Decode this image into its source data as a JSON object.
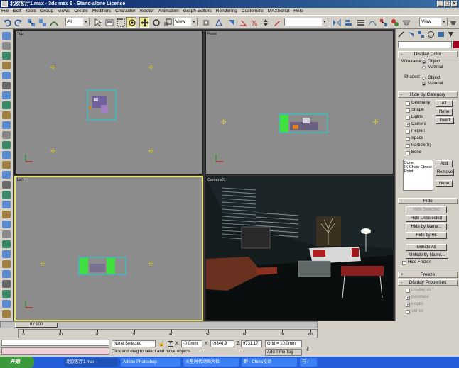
{
  "window": {
    "title": "北欧客厅1.max - 3ds max 6 - Stand-alone License"
  },
  "menu": [
    "File",
    "Edit",
    "Tools",
    "Group",
    "Views",
    "Create",
    "Modifiers",
    "Character",
    "reactor",
    "Animation",
    "Graph Editors",
    "Rendering",
    "Customize",
    "MAXScript",
    "Help"
  ],
  "toolbar": {
    "selection_filter": "All",
    "ref_coord": "View",
    "named_selection": "",
    "view_right": "View"
  },
  "viewports": [
    {
      "label": "Top"
    },
    {
      "label": "Front"
    },
    {
      "label": "Left"
    },
    {
      "label": "Camera01"
    }
  ],
  "command_panel": {
    "display_color": {
      "title": "Display Color",
      "wireframe_label": "Wireframe:",
      "shaded_label": "Shaded:",
      "object": "Object",
      "material": "Material"
    },
    "hide_by_category": {
      "title": "Hide by Category",
      "items": [
        {
          "label": "Geometry",
          "checked": false
        },
        {
          "label": "Shapes",
          "checked": false
        },
        {
          "label": "Lights",
          "checked": false
        },
        {
          "label": "Cameras",
          "checked": true
        },
        {
          "label": "Helpers",
          "checked": false
        },
        {
          "label": "Space Warps",
          "checked": false
        },
        {
          "label": "Particle Systems",
          "checked": false
        },
        {
          "label": "Bone Objects",
          "checked": false
        }
      ],
      "all_label": "All",
      "none_label": "None",
      "invert_label": "Invert",
      "list": [
        "Bone",
        "IK Chain Object",
        "Point"
      ],
      "add_label": "Add",
      "remove_label": "Remove",
      "none2_label": "None"
    },
    "hide": {
      "title": "Hide",
      "hide_selected": "Hide Selected",
      "hide_unselected": "Hide Unselected",
      "hide_by_name": "Hide by Name...",
      "hide_by_hit": "Hide by Hit",
      "unhide_all": "Unhide All",
      "unhide_by_name": "Unhide by Name...",
      "hide_frozen": "Hide Frozen"
    },
    "freeze": {
      "title": "Freeze"
    },
    "display_properties": {
      "title": "Display Properties",
      "items": [
        "Display as Box",
        "Backface Cull",
        "Edges Only",
        "Vertex Ticks"
      ]
    }
  },
  "timeline": {
    "frame_readout": "0 / 100",
    "ticks": [
      "0",
      "10",
      "20",
      "30",
      "40",
      "50",
      "60",
      "70",
      "80"
    ]
  },
  "status": {
    "selection": "None Selected",
    "prompt": "Click and drag to select and move objects",
    "x_label": "X:",
    "x_value": "-0.0mm",
    "y_label": "Y:",
    "y_value": "-9346.9",
    "z_label": "Z:",
    "z_value": "9731.17",
    "grid": "Grid = 10.0mm",
    "add_time_tag": "Add Time Tag"
  },
  "taskbar": {
    "start": "开始",
    "tasks": [
      "北欧客厅1.max -",
      "Adobe Photoshop",
      "火星时代动画大社",
      "群 - China设计",
      "与 /"
    ]
  },
  "colors": {
    "title_bar": "#0a246a",
    "viewport_bg": "#8c8c8c",
    "active_viewport_border": "#e8e070",
    "taskbar": "#245edb",
    "start_button": "#3c9a3c"
  }
}
